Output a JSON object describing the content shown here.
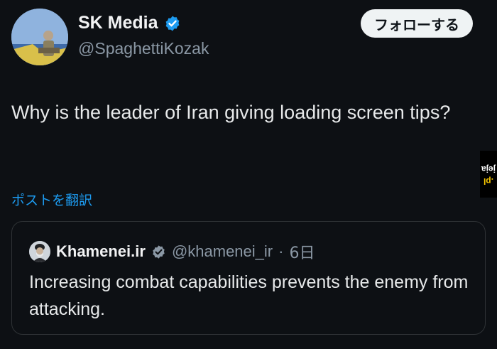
{
  "tweet": {
    "display_name": "SK Media",
    "handle": "@SpaghettiKozak",
    "follow_label": "フォローする",
    "text": "Why is the leader of Iran giving loading screen tips?",
    "translate_label": "ポストを翻訳"
  },
  "quoted": {
    "display_name": "Khamenei.ir",
    "handle": "@khamenei_ir",
    "separator": "·",
    "time": "6日",
    "text": "Increasing combat capabilities prevents the enemy from attacking."
  },
  "watermark": {
    "main": "jeja",
    "tail": ".pl"
  },
  "colors": {
    "background": "#0d1014",
    "verified_badge": "#1d9bf0",
    "link": "#1d9bf0",
    "follow_button_bg": "#eff3f4",
    "secondary_text": "#8b98a5"
  }
}
